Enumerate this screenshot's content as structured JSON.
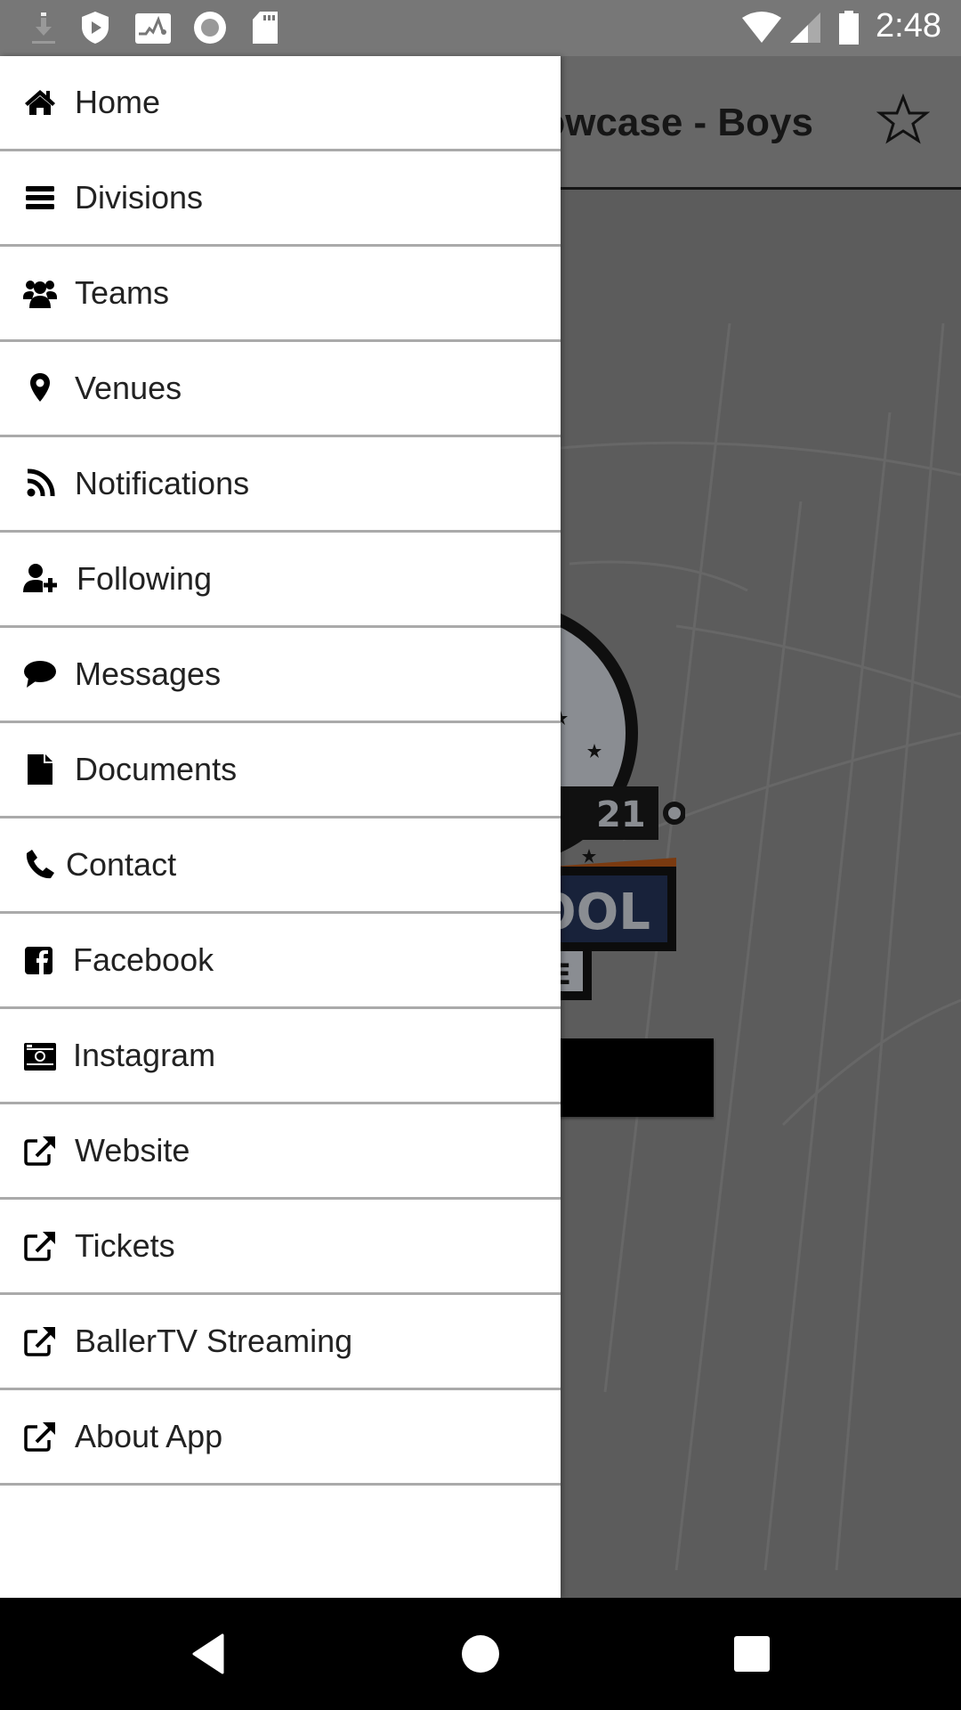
{
  "status_bar": {
    "time": "2:48",
    "icons_left": [
      "download-icon",
      "shield-play-icon",
      "activity-icon",
      "record-icon",
      "sd-card-icon"
    ],
    "icons_right": [
      "wifi-icon",
      "signal-icon",
      "battery-icon"
    ]
  },
  "header": {
    "title_visible": "owcase - Boys",
    "favorite_icon": "star-outline-icon"
  },
  "background": {
    "logo_text_fragments": [
      "21",
      "OOL",
      "E"
    ]
  },
  "drawer": {
    "items": [
      {
        "label": "Home",
        "icon": "home-icon"
      },
      {
        "label": "Divisions",
        "icon": "bars-icon"
      },
      {
        "label": "Teams",
        "icon": "users-icon"
      },
      {
        "label": "Venues",
        "icon": "map-marker-icon"
      },
      {
        "label": "Notifications",
        "icon": "rss-icon"
      },
      {
        "label": "Following",
        "icon": "user-plus-icon"
      },
      {
        "label": "Messages",
        "icon": "comment-icon"
      },
      {
        "label": "Documents",
        "icon": "file-icon"
      },
      {
        "label": "Contact",
        "icon": "phone-icon"
      },
      {
        "label": "Facebook",
        "icon": "facebook-square-icon"
      },
      {
        "label": "Instagram",
        "icon": "camera-icon"
      },
      {
        "label": "Website",
        "icon": "external-link-icon"
      },
      {
        "label": "Tickets",
        "icon": "external-link-icon"
      },
      {
        "label": "BallerTV Streaming",
        "icon": "external-link-icon"
      },
      {
        "label": "About App",
        "icon": "external-link-icon"
      }
    ]
  },
  "nav_bar": {
    "back": "back-icon",
    "home": "home-circle-icon",
    "recents": "recents-icon"
  }
}
